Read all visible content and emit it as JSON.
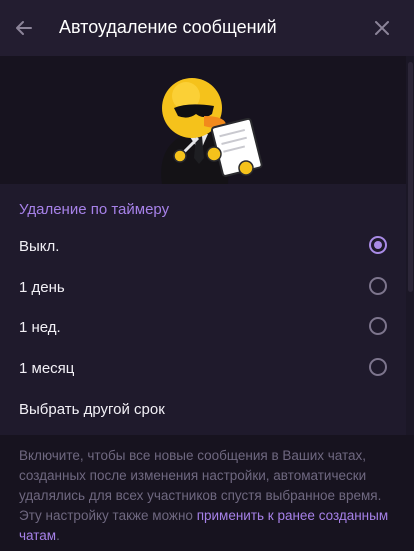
{
  "header": {
    "title": "Автоудаление сообщений",
    "back_icon": "arrow-left-icon",
    "close_icon": "close-icon"
  },
  "section": {
    "title": "Удаление по таймеру"
  },
  "options": [
    {
      "label": "Выкл.",
      "selected": true
    },
    {
      "label": "1 день",
      "selected": false
    },
    {
      "label": "1 нед.",
      "selected": false
    },
    {
      "label": "1 месяц",
      "selected": false
    }
  ],
  "custom_period": {
    "label": "Выбрать другой срок"
  },
  "footer": {
    "description": "Включите, чтобы все новые сообщения в Ваших чатах, созданных после изменения настройки, автоматически удалялись для всех участников спустя выбранное время. Эту настройку также можно",
    "link_text": "применить к ранее созданным чатам",
    "trailing": "."
  },
  "colors": {
    "accent": "#a681e8",
    "background": "#1f1a2c",
    "panel": "#17131f",
    "text": "#f2f0f6",
    "muted": "#6f6880"
  }
}
